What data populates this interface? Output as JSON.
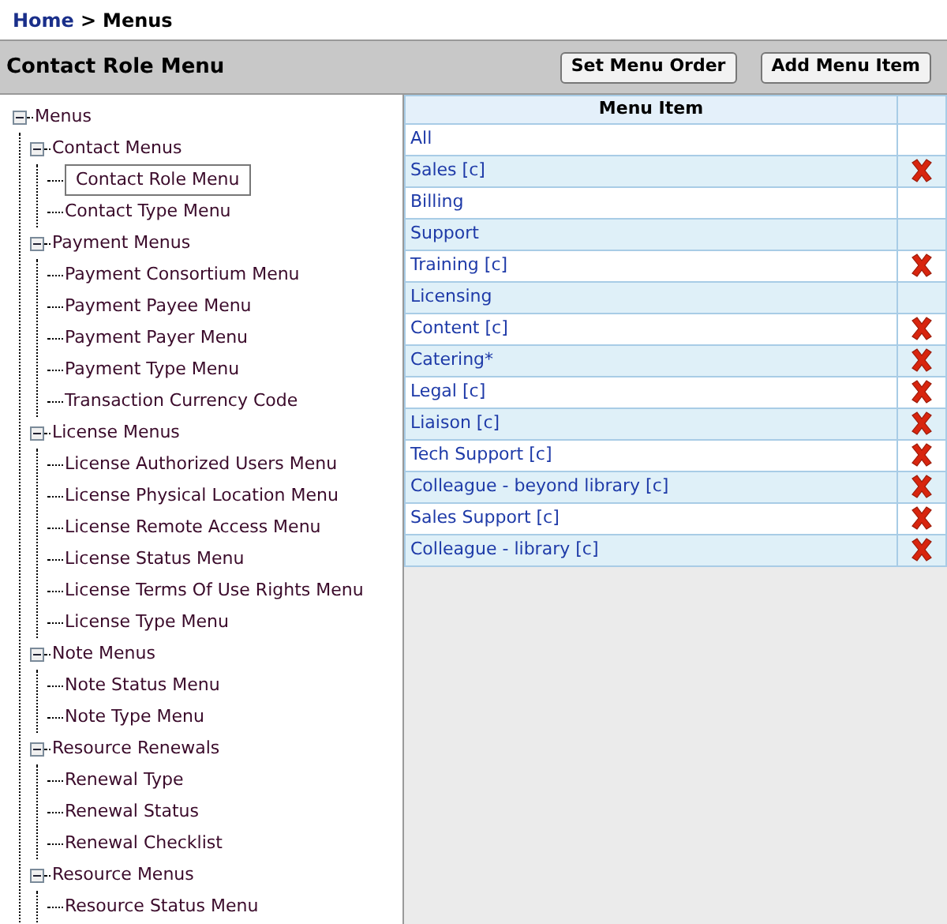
{
  "breadcrumb": {
    "link": "Home",
    "separator": ">",
    "current": "Menus"
  },
  "header": {
    "title": "Contact Role Menu",
    "buttons": [
      "Set Menu Order",
      "Add Menu Item"
    ]
  },
  "tree": [
    {
      "label": "Menus",
      "expanded": true,
      "selected": false,
      "children": [
        {
          "label": "Contact Menus",
          "expanded": true,
          "selected": false,
          "children": [
            {
              "label": "Contact Role Menu",
              "selected": true
            },
            {
              "label": "Contact Type Menu",
              "selected": false
            }
          ]
        },
        {
          "label": "Payment Menus",
          "expanded": true,
          "selected": false,
          "children": [
            {
              "label": "Payment Consortium Menu",
              "selected": false
            },
            {
              "label": "Payment Payee Menu",
              "selected": false
            },
            {
              "label": "Payment Payer Menu",
              "selected": false
            },
            {
              "label": "Payment Type Menu",
              "selected": false
            },
            {
              "label": "Transaction Currency Code",
              "selected": false
            }
          ]
        },
        {
          "label": "License Menus",
          "expanded": true,
          "selected": false,
          "children": [
            {
              "label": "License Authorized Users Menu",
              "selected": false
            },
            {
              "label": "License Physical Location Menu",
              "selected": false
            },
            {
              "label": "License Remote Access Menu",
              "selected": false
            },
            {
              "label": "License Status Menu",
              "selected": false
            },
            {
              "label": "License Terms Of Use Rights Menu",
              "selected": false
            },
            {
              "label": "License Type Menu",
              "selected": false
            }
          ]
        },
        {
          "label": "Note Menus",
          "expanded": true,
          "selected": false,
          "children": [
            {
              "label": "Note Status Menu",
              "selected": false
            },
            {
              "label": "Note Type Menu",
              "selected": false
            }
          ]
        },
        {
          "label": "Resource Renewals",
          "expanded": true,
          "selected": false,
          "children": [
            {
              "label": "Renewal Type",
              "selected": false
            },
            {
              "label": "Renewal Status",
              "selected": false
            },
            {
              "label": "Renewal Checklist",
              "selected": false
            }
          ]
        },
        {
          "label": "Resource Menus",
          "expanded": true,
          "selected": false,
          "children": [
            {
              "label": "Resource Status Menu",
              "selected": false
            }
          ]
        }
      ]
    }
  ],
  "table": {
    "columns": [
      "Menu Item"
    ],
    "rows": [
      {
        "label": "All",
        "deletable": false
      },
      {
        "label": "Sales [c]",
        "deletable": true
      },
      {
        "label": "Billing",
        "deletable": false
      },
      {
        "label": "Support",
        "deletable": false
      },
      {
        "label": "Training [c]",
        "deletable": true
      },
      {
        "label": "Licensing",
        "deletable": false
      },
      {
        "label": "Content [c]",
        "deletable": true
      },
      {
        "label": "Catering*",
        "deletable": true
      },
      {
        "label": "Legal [c]",
        "deletable": true
      },
      {
        "label": "Liaison [c]",
        "deletable": true
      },
      {
        "label": "Tech Support [c]",
        "deletable": true
      },
      {
        "label": "Colleague - beyond library [c]",
        "deletable": true
      },
      {
        "label": "Sales Support [c]",
        "deletable": true
      },
      {
        "label": "Colleague - library [c]",
        "deletable": true
      }
    ]
  }
}
